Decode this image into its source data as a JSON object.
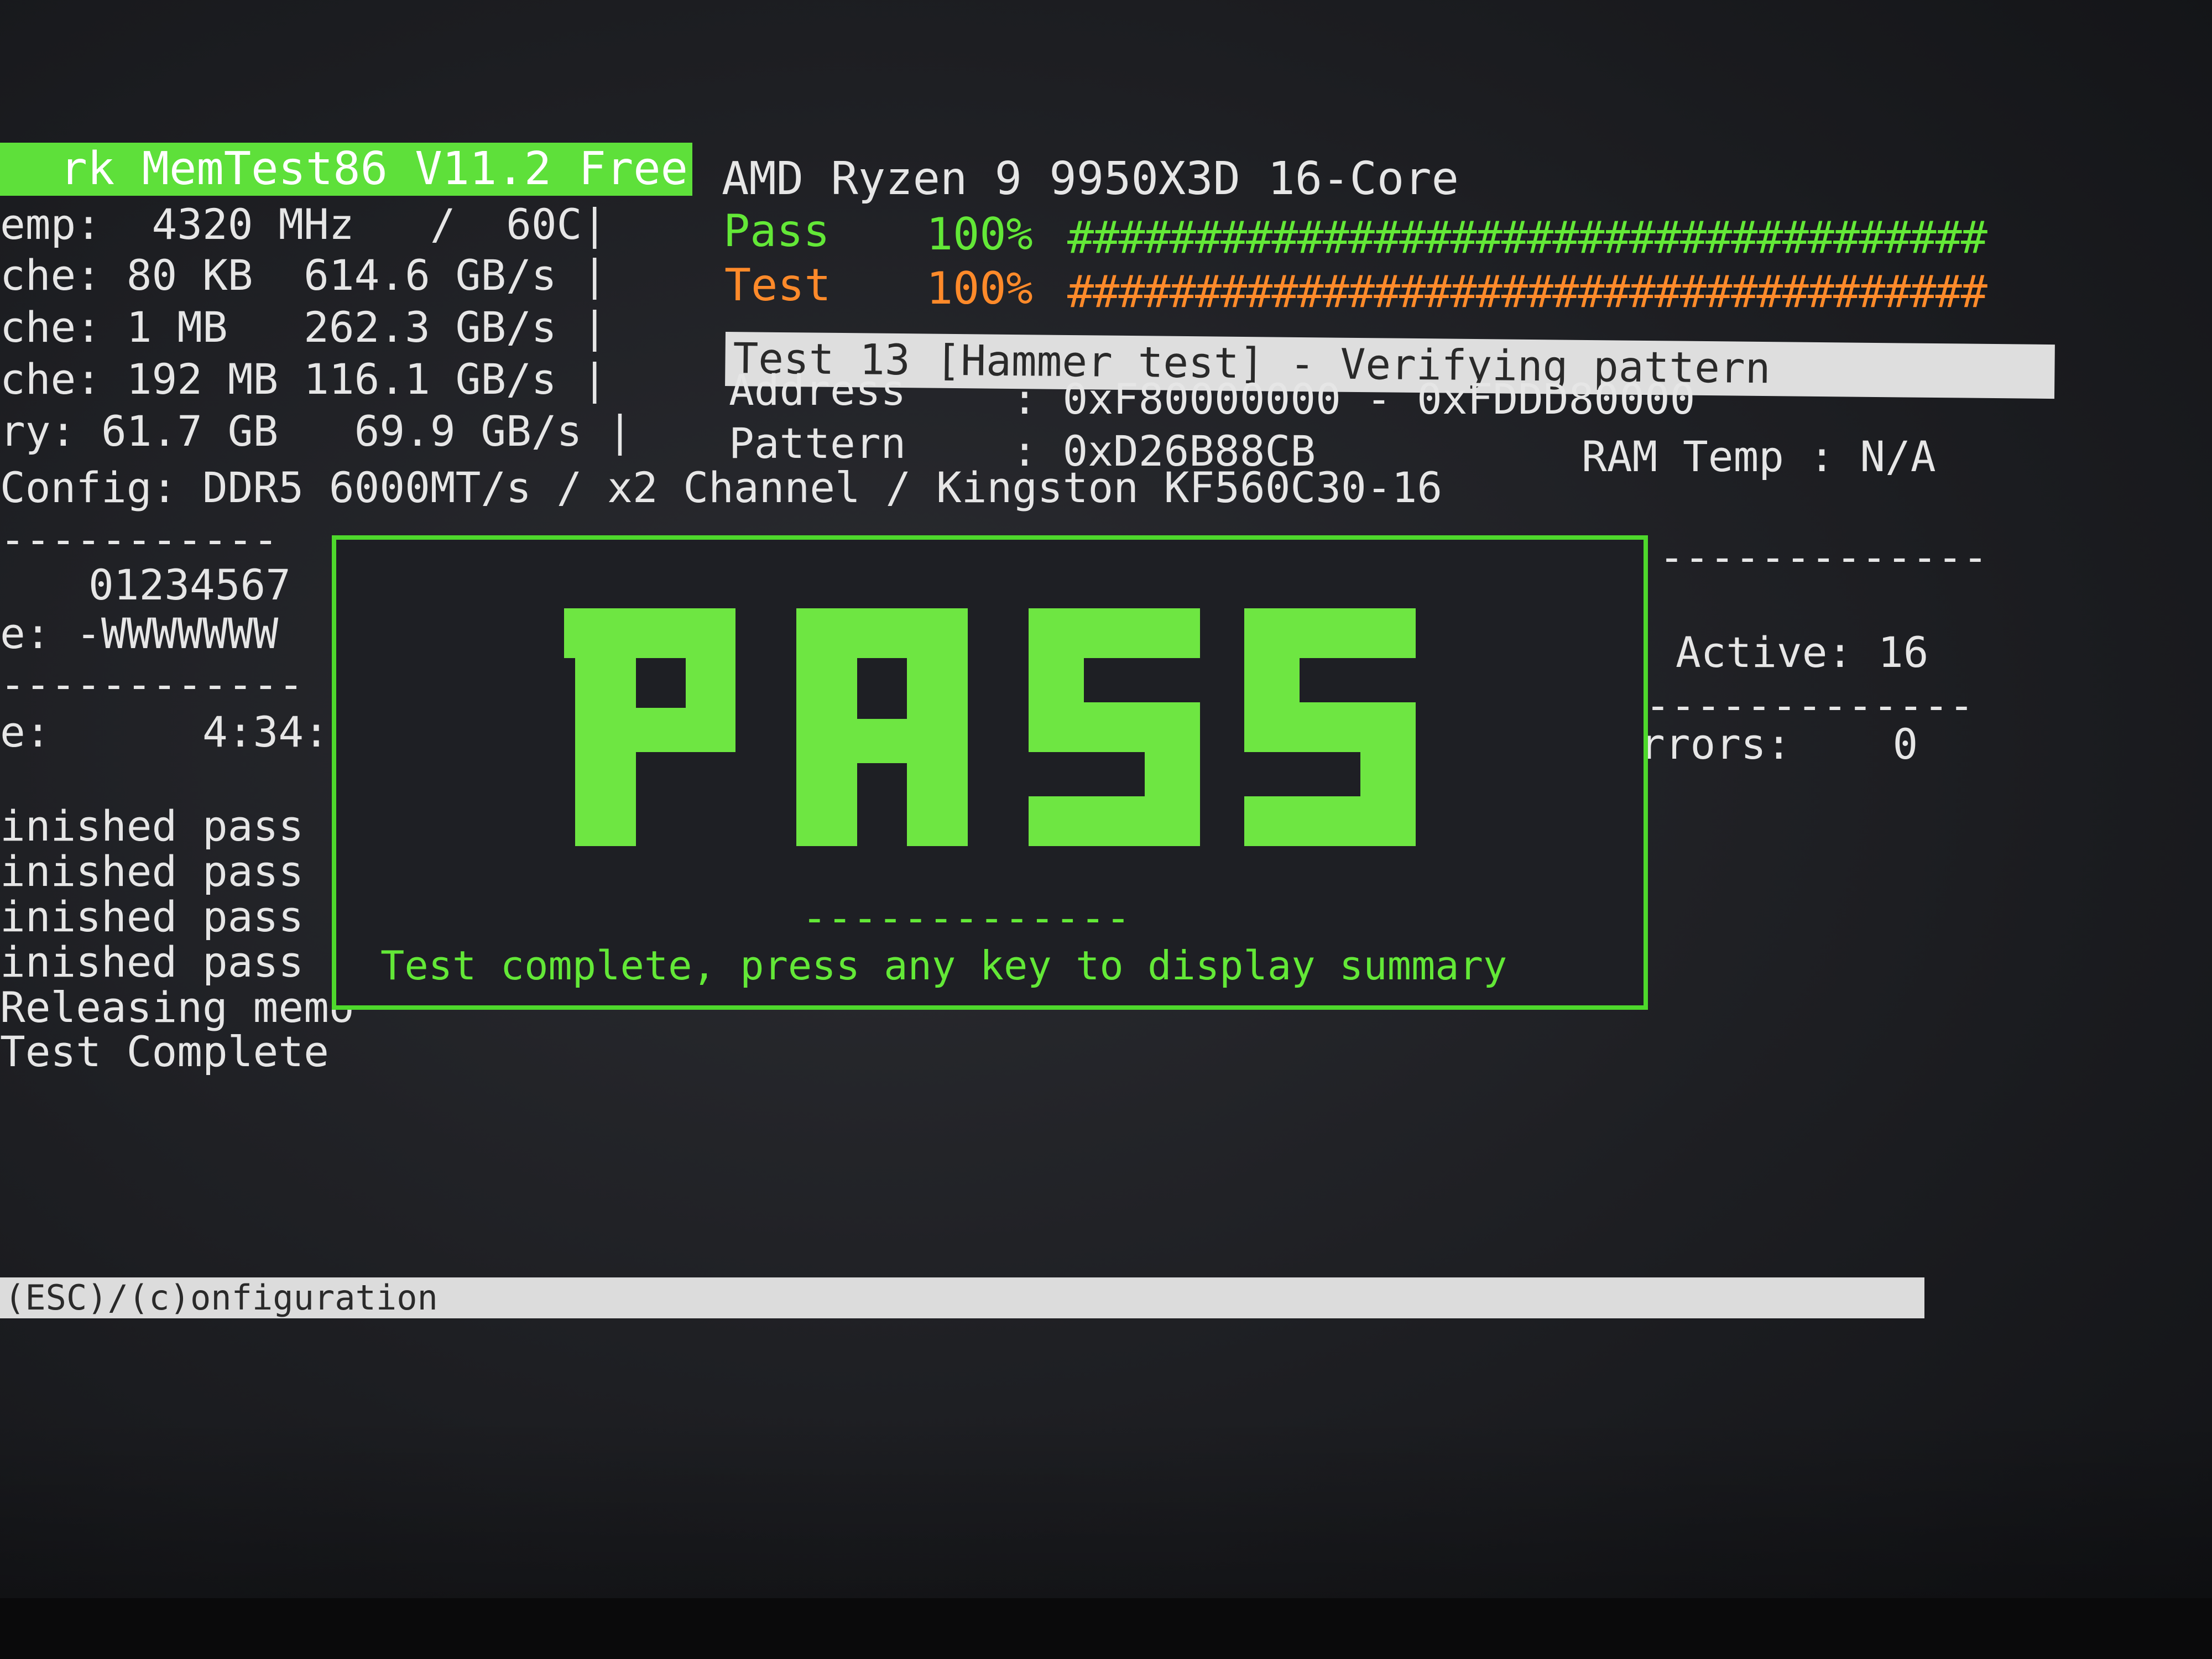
{
  "header": {
    "title": "rk MemTest86 V11.2 Free",
    "cpu": "AMD Ryzen 9 9950X3D 16-Core"
  },
  "left_panel": {
    "lines": [
      "emp:  4320 MHz   /  60C|",
      "che: 80 KB  614.6 GB/s |",
      "che: 1 MB   262.3 GB/s |",
      "che: 192 MB 116.1 GB/s |",
      "ry: 61.7 GB   69.9 GB/s |"
    ],
    "config": "Config: DDR5 6000MT/s / x2 Channel / Kingston KF560C30-16",
    "divider1": "-----------",
    "cpu_map": "01234567",
    "state_line": "e: -WWWWWWW",
    "divider2": "------------",
    "time_line": "e:      4:34:",
    "log": [
      "inished pass",
      "inished pass",
      "inished pass",
      "inished pass",
      "Releasing memo",
      "Test Complete"
    ]
  },
  "progress": {
    "pass_label": "Pass",
    "pass_percent": "100%",
    "pass_fraction": 1.0,
    "pass_hashes": "####################################",
    "test_label": "Test",
    "test_percent": "100%",
    "test_fraction": 1.0,
    "test_hashes": "####################################"
  },
  "test_info": {
    "current_test": "Test 13 [Hammer test] - Verifying pattern",
    "address_label": "Address",
    "address_value": ": 0xF80000000 - 0xFDDD80000",
    "pattern_label": "Pattern",
    "pattern_value": ": 0xD26B88CB",
    "ram_temp": "RAM Temp : N/A"
  },
  "right_panel": {
    "divider1": "-------------",
    "active": "Active: 16",
    "divider2": "-------------",
    "errors": "rrors:    0"
  },
  "result_box": {
    "letters": [
      "P",
      "A",
      "S",
      "S"
    ],
    "divider": "-------------",
    "message": "Test complete, press any key to display summary"
  },
  "footer": {
    "hint": "(ESC)/(c)onfiguration"
  },
  "colors": {
    "accent_green": "#63e837",
    "orange": "#ff8a2a",
    "background": "#1f2025"
  }
}
